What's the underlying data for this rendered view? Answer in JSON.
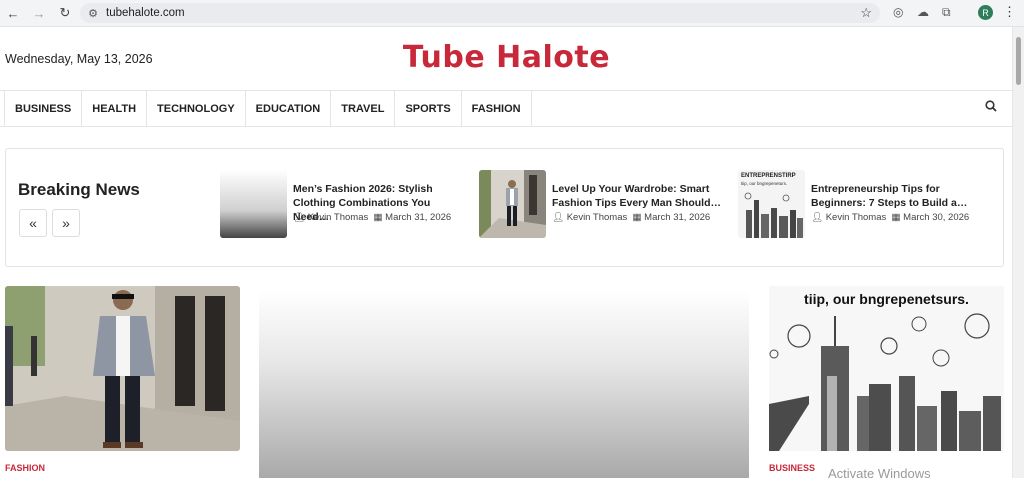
{
  "browser": {
    "url": "tubehalote.com",
    "avatar_letter": "R",
    "icons": [
      "back-icon",
      "forward-icon",
      "reload-icon",
      "tune-icon",
      "bookmark-star-icon",
      "extension-icon",
      "puzzle-icon",
      "menu-icon"
    ]
  },
  "header": {
    "date": "Wednesday, May 13, 2026",
    "logo": "Tube Halote",
    "brand_color": "#c7283a"
  },
  "nav": {
    "items": [
      "BUSINESS",
      "HEALTH",
      "TECHNOLOGY",
      "EDUCATION",
      "TRAVEL",
      "SPORTS",
      "FASHION"
    ]
  },
  "breaking": {
    "title": "Breaking News",
    "prev_label": "«",
    "next_label": "»",
    "items": [
      {
        "title": "Men’s Fashion 2026: Stylish Clothing Combinations You Need…",
        "author": "Kevin Thomas",
        "date": "March 31, 2026"
      },
      {
        "title": "Level Up Your Wardrobe: Smart Fashion Tips Every Man Should…",
        "author": "Kevin Thomas",
        "date": "March 31, 2026"
      },
      {
        "title": "Entrepreneurship Tips for Beginners: 7 Steps to Build a…",
        "author": "Kevin Thomas",
        "date": "March 30, 2026",
        "thumb_text_1": "ENTREPRENSTIRP",
        "thumb_text_2": "tiip, our bngrepeneturs."
      }
    ]
  },
  "cards": {
    "left_category": "FASHION",
    "right_category": "BUSINESS",
    "right_image_caption": "tiip, our bngrepenetsurs."
  },
  "watermark": "Activate Windows"
}
